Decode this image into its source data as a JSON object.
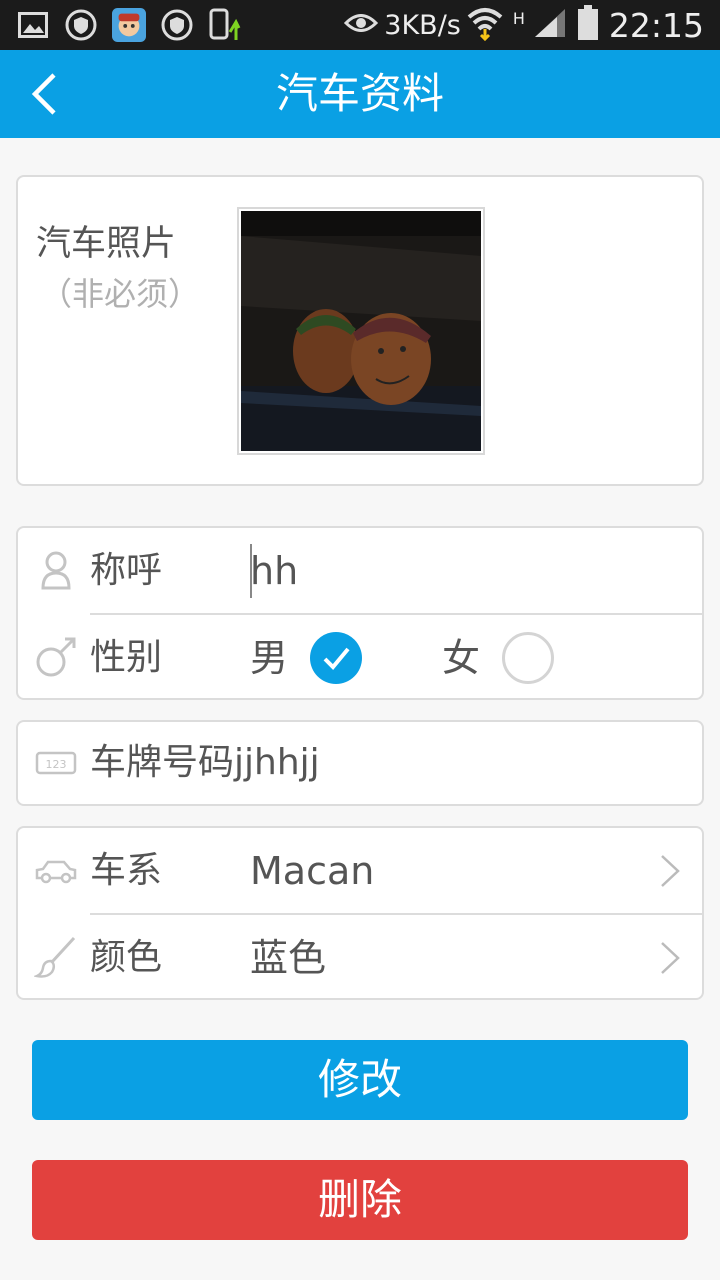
{
  "status_bar": {
    "speed": "3KB/s",
    "network": "H",
    "time": "22:15"
  },
  "header": {
    "title": "汽车资料"
  },
  "photo": {
    "label": "汽车照片",
    "sub": "（非必须）"
  },
  "profile": {
    "name_label": "称呼",
    "name_value": "hh",
    "gender_label": "性别",
    "gender_male": "男",
    "gender_female": "女",
    "selected_gender": "男"
  },
  "plate": {
    "text": "车牌号码jjhhjj"
  },
  "car": {
    "series_label": "车系",
    "series_value": "Macan",
    "color_label": "颜色",
    "color_value": "蓝色"
  },
  "actions": {
    "edit_label": "修改",
    "delete_label": "删除"
  },
  "colors": {
    "accent": "#0aa0e4",
    "danger": "#e2413e"
  }
}
